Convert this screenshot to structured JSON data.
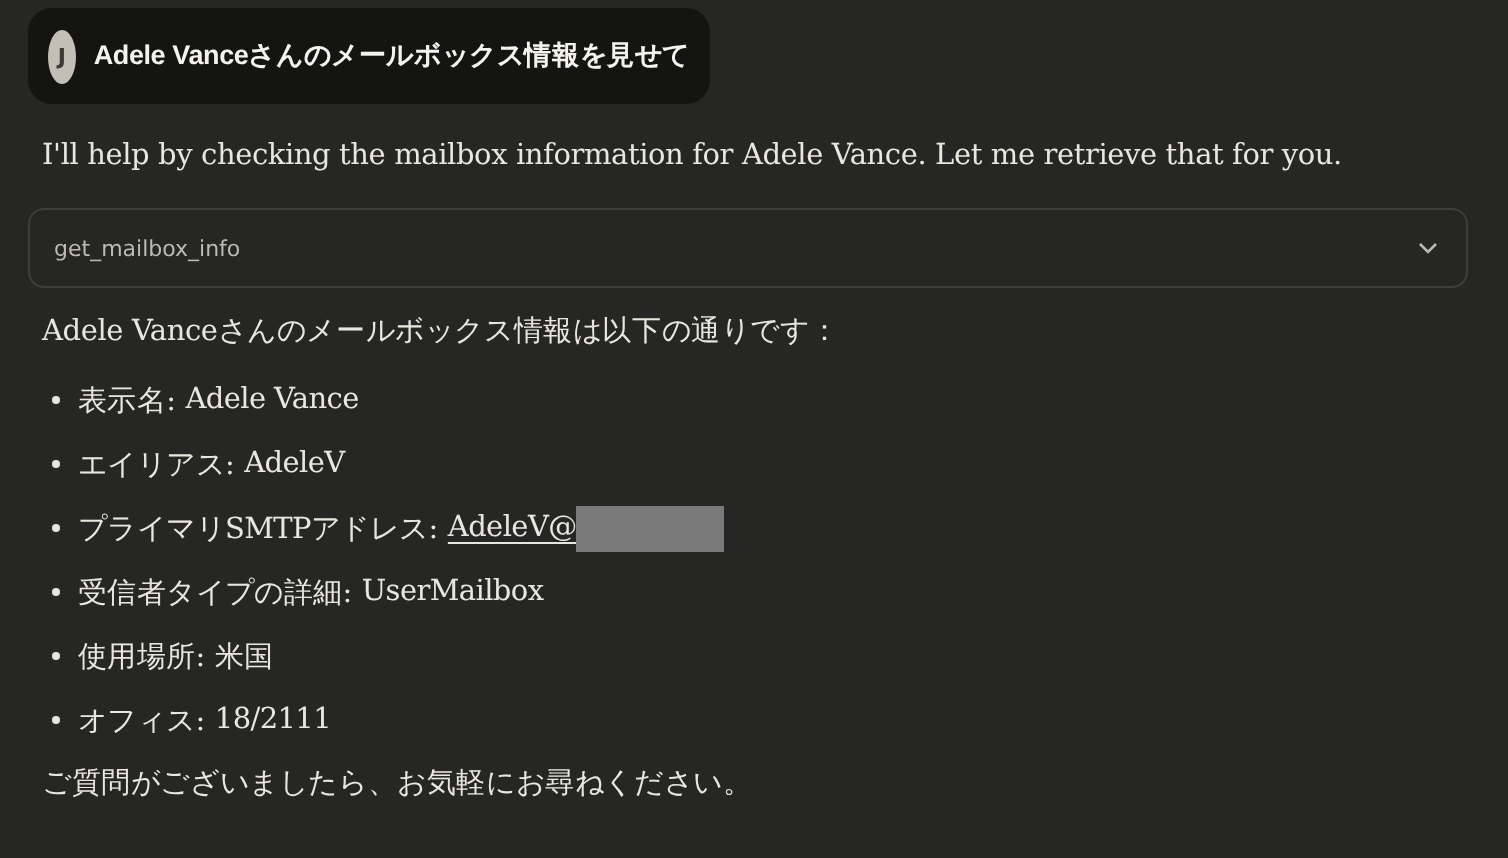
{
  "user_message": {
    "avatar": "J",
    "text": "Adele Vanceさんのメールボックス情報を見せて"
  },
  "assistant_intro": "I'll help by checking the mailbox information for Adele Vance. Let me retrieve that for you.",
  "tool_call": {
    "name": "get_mailbox_info",
    "expanded": false
  },
  "answer_intro": "Adele Vanceさんのメールボックス情報は以下の通りです：",
  "details": [
    {
      "kind": "text",
      "label": "表示名:",
      "value": "Adele Vance"
    },
    {
      "kind": "text",
      "label": "エイリアス:",
      "value": "AdeleV"
    },
    {
      "kind": "link",
      "label": "プライマリSMTPアドレス:",
      "value": "AdeleV@",
      "redacted": true
    },
    {
      "kind": "text",
      "label": "受信者タイプの詳細:",
      "value": "UserMailbox"
    },
    {
      "kind": "text",
      "label": "使用場所:",
      "value": "米国"
    },
    {
      "kind": "text",
      "label": "オフィス:",
      "value": "18/2111"
    }
  ],
  "closing": "ご質問がございましたら、お気軽にお尋ねください。"
}
